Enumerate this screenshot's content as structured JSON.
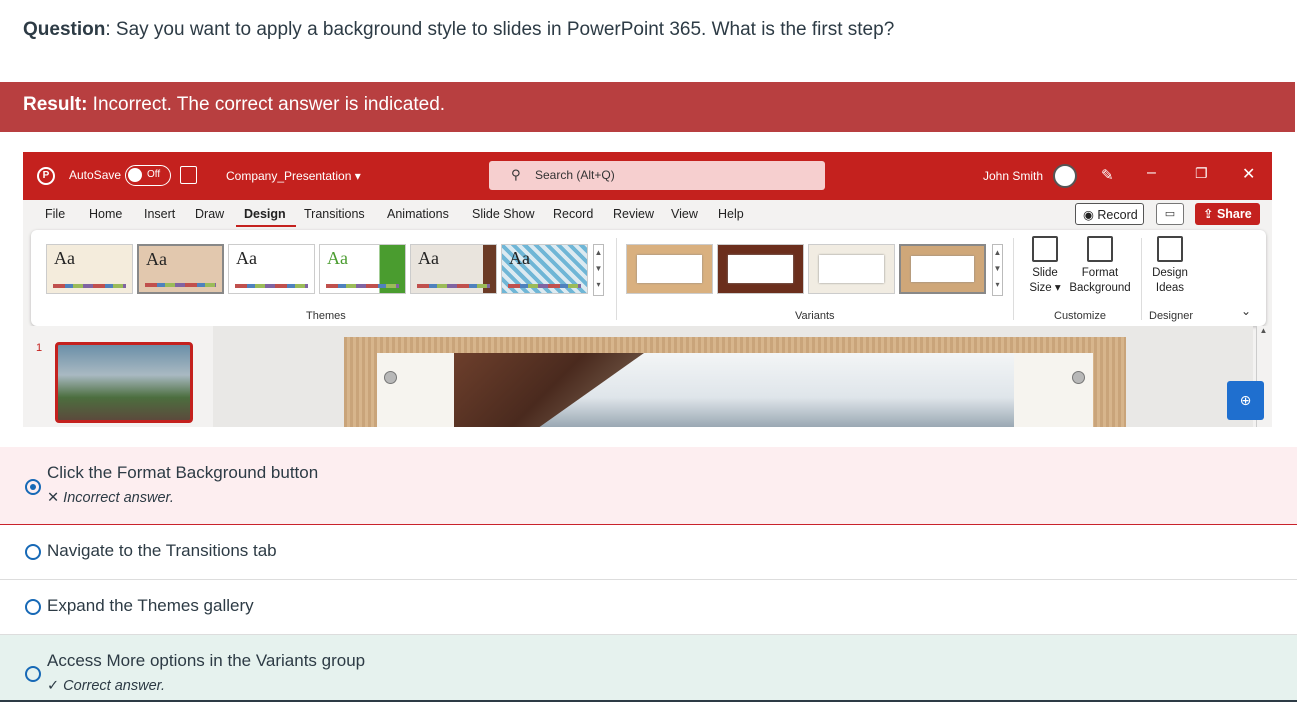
{
  "question": {
    "prefix": "Question",
    "text": ": Say you want to apply a background style to slides in PowerPoint 365. What is the first step?"
  },
  "result": {
    "prefix": "Result:",
    "text": " Incorrect. The correct answer is indicated.",
    "color": "#b83f40"
  },
  "powerpoint": {
    "accent": "#c4211e",
    "autosave_label": "AutoSave",
    "autosave_state": "Off",
    "doc_name": "Company_Presentation ▾",
    "search_placeholder": "Search (Alt+Q)",
    "user_name": "John Smith",
    "tabs": [
      "File",
      "Home",
      "Insert",
      "Draw",
      "Design",
      "Transitions",
      "Animations",
      "Slide Show",
      "Record",
      "Review",
      "View",
      "Help"
    ],
    "active_tab": "Design",
    "record_label": "Record",
    "share_label": "Share",
    "theme_sample_text": "Aa",
    "group_themes": "Themes",
    "group_variants": "Variants",
    "group_customize": "Customize",
    "group_designer": "Designer",
    "slide_size_label": "Slide Size ▾",
    "format_background_label": "Format Background",
    "design_ideas_label": "Design Ideas",
    "slide_number": "1"
  },
  "options": [
    {
      "label": "Click the Format Background button",
      "selected": true,
      "note": "✕ Incorrect answer."
    },
    {
      "label": "Navigate to the Transitions tab",
      "selected": false,
      "note": ""
    },
    {
      "label": "Expand the Themes gallery",
      "selected": false,
      "note": ""
    },
    {
      "label": "Access More options in the Variants group",
      "selected": false,
      "note": "✓ Correct answer."
    }
  ]
}
